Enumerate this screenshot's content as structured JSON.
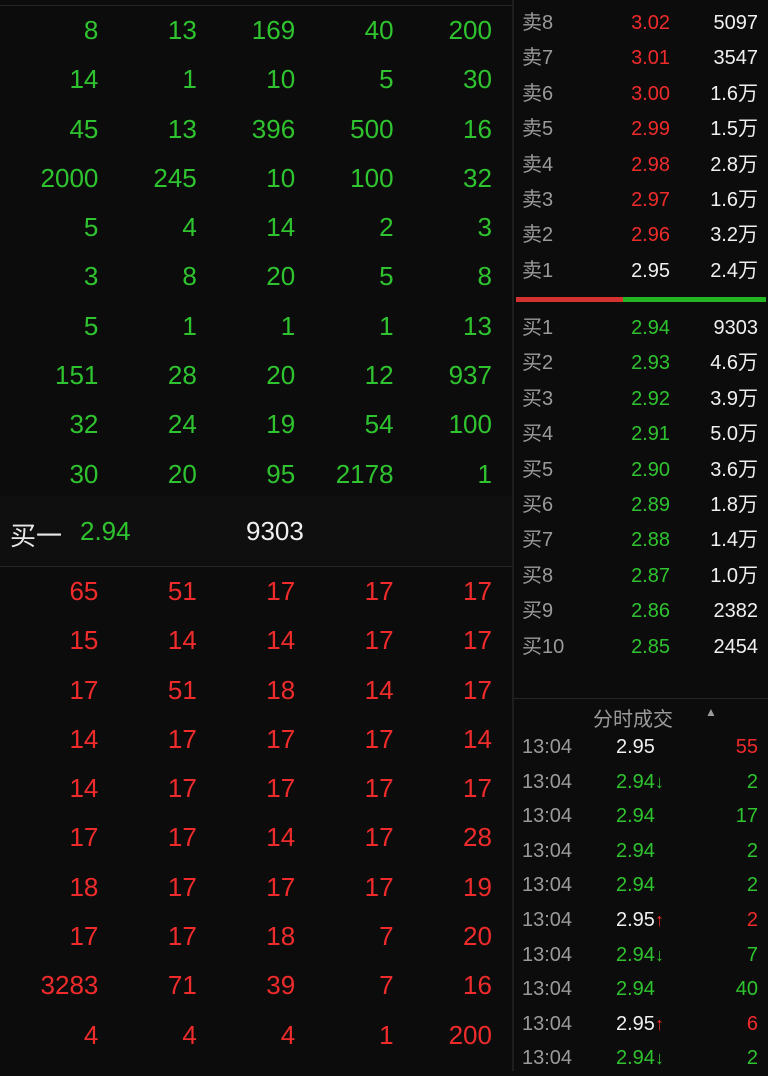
{
  "colors": {
    "green": "#2fc42f",
    "red": "#ef2b2b",
    "white": "#f0f0f0",
    "muted": "#9a9a9a"
  },
  "top_grid": [
    [
      "8",
      "13",
      "169",
      "40",
      "200"
    ],
    [
      "14",
      "1",
      "10",
      "5",
      "30"
    ],
    [
      "45",
      "13",
      "396",
      "500",
      "16"
    ],
    [
      "2000",
      "245",
      "10",
      "100",
      "32"
    ],
    [
      "5",
      "4",
      "14",
      "2",
      "3"
    ],
    [
      "3",
      "8",
      "20",
      "5",
      "8"
    ],
    [
      "5",
      "1",
      "1",
      "1",
      "13"
    ],
    [
      "151",
      "28",
      "20",
      "12",
      "937"
    ],
    [
      "32",
      "24",
      "19",
      "54",
      "100"
    ],
    [
      "30",
      "20",
      "95",
      "2178",
      "1"
    ]
  ],
  "buy_one": {
    "label": "买一",
    "price": "2.94",
    "volume": "9303"
  },
  "bottom_grid": [
    [
      "65",
      "51",
      "17",
      "17",
      "17"
    ],
    [
      "15",
      "14",
      "14",
      "17",
      "17"
    ],
    [
      "17",
      "51",
      "18",
      "14",
      "17"
    ],
    [
      "14",
      "17",
      "17",
      "17",
      "14"
    ],
    [
      "14",
      "17",
      "17",
      "17",
      "17"
    ],
    [
      "17",
      "17",
      "14",
      "17",
      "28"
    ],
    [
      "18",
      "17",
      "17",
      "17",
      "19"
    ],
    [
      "17",
      "17",
      "18",
      "7",
      "20"
    ],
    [
      "3283",
      "71",
      "39",
      "7",
      "16"
    ],
    [
      "4",
      "4",
      "4",
      "1",
      "200"
    ]
  ],
  "sell_orders": [
    {
      "label": "卖8",
      "price": "3.02",
      "volume": "5097",
      "color": "red"
    },
    {
      "label": "卖7",
      "price": "3.01",
      "volume": "3547",
      "color": "red"
    },
    {
      "label": "卖6",
      "price": "3.00",
      "volume": "1.6万",
      "color": "red"
    },
    {
      "label": "卖5",
      "price": "2.99",
      "volume": "1.5万",
      "color": "red"
    },
    {
      "label": "卖4",
      "price": "2.98",
      "volume": "2.8万",
      "color": "red"
    },
    {
      "label": "卖3",
      "price": "2.97",
      "volume": "1.6万",
      "color": "red"
    },
    {
      "label": "卖2",
      "price": "2.96",
      "volume": "3.2万",
      "color": "red"
    },
    {
      "label": "卖1",
      "price": "2.95",
      "volume": "2.4万",
      "color": "white"
    }
  ],
  "buy_orders": [
    {
      "label": "买1",
      "price": "2.94",
      "volume": "9303"
    },
    {
      "label": "买2",
      "price": "2.93",
      "volume": "4.6万"
    },
    {
      "label": "买3",
      "price": "2.92",
      "volume": "3.9万"
    },
    {
      "label": "买4",
      "price": "2.91",
      "volume": "5.0万"
    },
    {
      "label": "买5",
      "price": "2.90",
      "volume": "3.6万"
    },
    {
      "label": "买6",
      "price": "2.89",
      "volume": "1.8万"
    },
    {
      "label": "买7",
      "price": "2.88",
      "volume": "1.4万"
    },
    {
      "label": "买8",
      "price": "2.87",
      "volume": "1.0万"
    },
    {
      "label": "买9",
      "price": "2.86",
      "volume": "2382"
    },
    {
      "label": "买10",
      "price": "2.85",
      "volume": "2454"
    }
  ],
  "trades_header": {
    "title": "分时成交",
    "sort_icon": "caret-up-icon"
  },
  "trades": [
    {
      "time": "13:04",
      "price": "2.95",
      "arrow": "",
      "price_color": "white",
      "volume": "55",
      "volume_color": "red"
    },
    {
      "time": "13:04",
      "price": "2.94",
      "arrow": "↓",
      "price_color": "green",
      "volume": "2",
      "volume_color": "green"
    },
    {
      "time": "13:04",
      "price": "2.94",
      "arrow": "",
      "price_color": "green",
      "volume": "17",
      "volume_color": "green"
    },
    {
      "time": "13:04",
      "price": "2.94",
      "arrow": "",
      "price_color": "green",
      "volume": "2",
      "volume_color": "green"
    },
    {
      "time": "13:04",
      "price": "2.94",
      "arrow": "",
      "price_color": "green",
      "volume": "2",
      "volume_color": "green"
    },
    {
      "time": "13:04",
      "price": "2.95",
      "arrow": "↑",
      "price_color": "white",
      "volume": "2",
      "volume_color": "red"
    },
    {
      "time": "13:04",
      "price": "2.94",
      "arrow": "↓",
      "price_color": "green",
      "volume": "7",
      "volume_color": "green"
    },
    {
      "time": "13:04",
      "price": "2.94",
      "arrow": "",
      "price_color": "green",
      "volume": "40",
      "volume_color": "green"
    },
    {
      "time": "13:04",
      "price": "2.95",
      "arrow": "↑",
      "price_color": "white",
      "volume": "6",
      "volume_color": "red"
    },
    {
      "time": "13:04",
      "price": "2.94",
      "arrow": "↓",
      "price_color": "green",
      "volume": "2",
      "volume_color": "green"
    }
  ]
}
